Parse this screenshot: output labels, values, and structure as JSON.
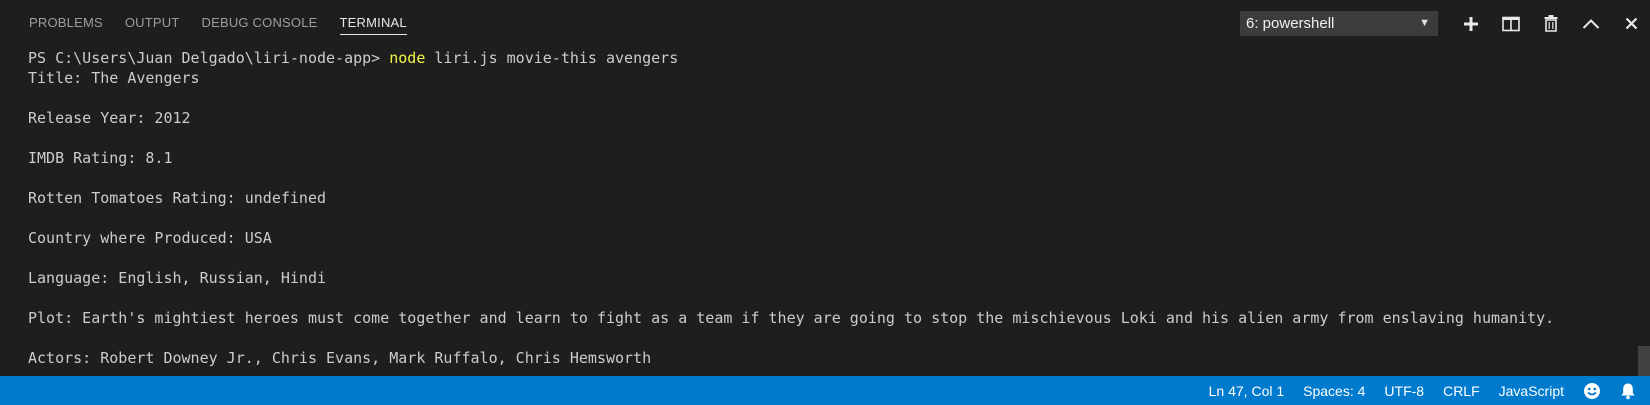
{
  "panel": {
    "tabs": [
      {
        "label": "PROBLEMS"
      },
      {
        "label": "OUTPUT"
      },
      {
        "label": "DEBUG CONSOLE"
      },
      {
        "label": "TERMINAL",
        "active": true
      }
    ],
    "terminal_select": {
      "value": "6: powershell"
    },
    "actions": [
      "plus-icon",
      "split-icon",
      "trash-icon",
      "chevron-up-icon",
      "close-icon"
    ]
  },
  "terminal": {
    "prompt": "PS C:\\Users\\Juan Delgado\\liri-node-app> ",
    "command_keyword": "node",
    "command_args": " liri.js movie-this avengers",
    "output": [
      "Title: The Avengers",
      "",
      "Release Year: 2012",
      "",
      "IMDB Rating: 8.1",
      "",
      "Rotten Tomatoes Rating: undefined",
      "",
      "Country where Produced: USA",
      "",
      "Language: English, Russian, Hindi",
      "",
      "Plot: Earth's mightiest heroes must come together and learn to fight as a team if they are going to stop the mischievous Loki and his alien army from enslaving humanity.",
      "",
      "Actors: Robert Downey Jr., Chris Evans, Mark Ruffalo, Chris Hemsworth"
    ]
  },
  "status_bar": {
    "position": "Ln 47, Col 1",
    "spaces": "Spaces: 4",
    "encoding": "UTF-8",
    "eol": "CRLF",
    "language": "JavaScript",
    "icons": [
      "smiley-icon",
      "bell-icon"
    ]
  },
  "colors": {
    "background": "#1e1e1e",
    "status_bar": "#007acc",
    "command_highlight": "#f5f543"
  }
}
